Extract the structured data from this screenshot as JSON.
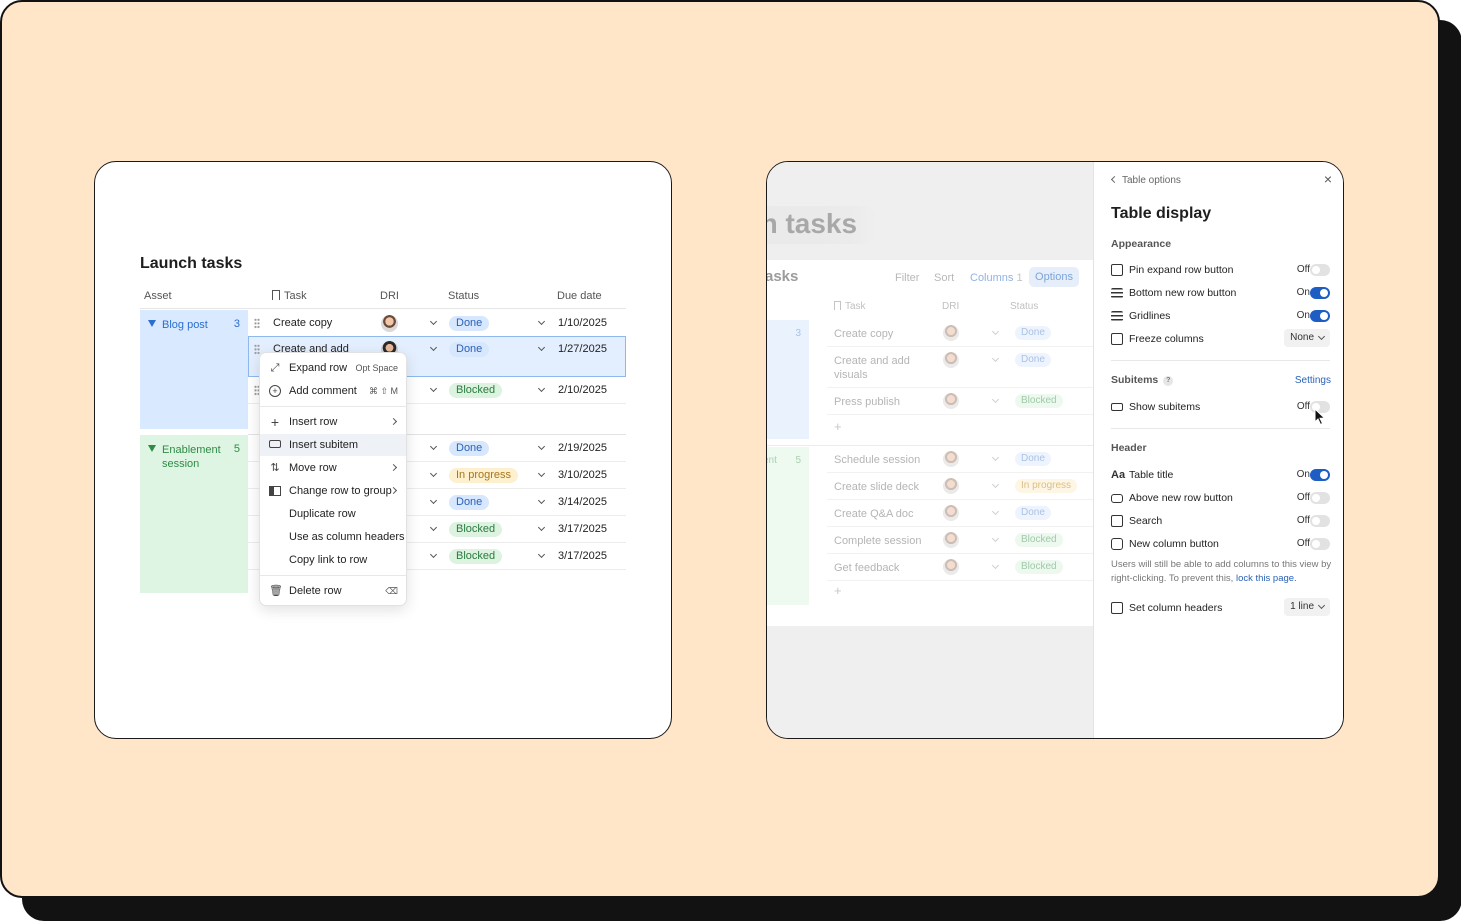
{
  "left_card": {
    "title": "Launch tasks",
    "columns": [
      "Asset",
      "Task",
      "DRI",
      "Status",
      "Due date"
    ],
    "groups": [
      {
        "label": "Blog post",
        "count": "3"
      },
      {
        "label": "Enablement session",
        "count": "5"
      }
    ],
    "rows": [
      {
        "task": "Create copy",
        "status": "Done",
        "due": "1/10/2025"
      },
      {
        "task": "Create and add",
        "status": "Done",
        "due": "1/27/2025"
      },
      {
        "task": "",
        "status": "Blocked",
        "due": "2/10/2025"
      },
      {
        "task": "",
        "status": "Done",
        "due": "2/19/2025"
      },
      {
        "task": "",
        "status": "In progress",
        "due": "3/10/2025"
      },
      {
        "task": "",
        "status": "Done",
        "due": "3/14/2025"
      },
      {
        "task": "",
        "status": "Blocked",
        "due": "3/17/2025"
      },
      {
        "task": "",
        "status": "Blocked",
        "due": "3/17/2025"
      }
    ],
    "context_menu": {
      "items": [
        {
          "label": "Expand row",
          "shortcut": "Opt Space",
          "icon": "expand-icon"
        },
        {
          "label": "Add comment",
          "shortcut": "⌘ ⇧ M",
          "icon": "comment-icon"
        },
        {
          "label": "Insert row",
          "icon": "plus-icon"
        },
        {
          "label": "Insert subitem",
          "icon": "subitem-icon"
        },
        {
          "label": "Move row",
          "icon": "move-icon"
        },
        {
          "label": "Change row to group",
          "icon": "group-icon"
        },
        {
          "label": "Duplicate row"
        },
        {
          "label": "Use as column headers"
        },
        {
          "label": "Copy link to row"
        },
        {
          "label": "Delete row",
          "shortcut": "⌫",
          "icon": "trash-icon"
        }
      ]
    }
  },
  "right_card": {
    "background": {
      "page_title": "ch tasks",
      "table_title": "asks",
      "toolbar": {
        "filter": "Filter",
        "sort": "Sort",
        "columns": "Columns",
        "columns_count": "1",
        "options": "Options"
      },
      "columns": [
        "Task",
        "DRI",
        "Status"
      ],
      "group_counts": [
        "3",
        "5"
      ],
      "group_label": "ent",
      "plus": "+",
      "rows": [
        {
          "task": "Create copy",
          "status": "Done"
        },
        {
          "task": "Create and add visuals",
          "status": "Done"
        },
        {
          "task": "Press publish",
          "status": "Blocked"
        },
        {
          "task": "Schedule session",
          "status": "Done"
        },
        {
          "task": "Create slide deck",
          "status": "In progress"
        },
        {
          "task": "Create Q&A doc",
          "status": "Done"
        },
        {
          "task": "Complete session",
          "status": "Blocked"
        },
        {
          "task": "Get feedback",
          "status": "Blocked"
        }
      ]
    },
    "panel": {
      "back_label": "Table options",
      "close_glyph": "×",
      "title": "Table display",
      "appearance": {
        "heading": "Appearance",
        "items": [
          {
            "label": "Pin expand row button",
            "state": "Off",
            "on": false
          },
          {
            "label": "Bottom new row button",
            "state": "On",
            "on": true
          },
          {
            "label": "Gridlines",
            "state": "On",
            "on": true
          },
          {
            "label": "Freeze columns",
            "value": "None"
          }
        ]
      },
      "subitems": {
        "heading": "Subitems",
        "help": "?",
        "settings_link": "Settings",
        "items": [
          {
            "label": "Show subitems",
            "state": "Off",
            "on": false
          }
        ]
      },
      "header": {
        "heading": "Header",
        "items": [
          {
            "label": "Table title",
            "state": "On",
            "on": true
          },
          {
            "label": "Above new row button",
            "state": "Off",
            "on": false
          },
          {
            "label": "Search",
            "state": "Off",
            "on": false
          },
          {
            "label": "New column button",
            "state": "Off",
            "on": false
          }
        ],
        "note": "Users will still be able to add columns to this view by right-clicking. To prevent this,",
        "note_link": "lock this page.",
        "set_headers": {
          "label": "Set column headers",
          "value": "1 line"
        }
      }
    }
  }
}
